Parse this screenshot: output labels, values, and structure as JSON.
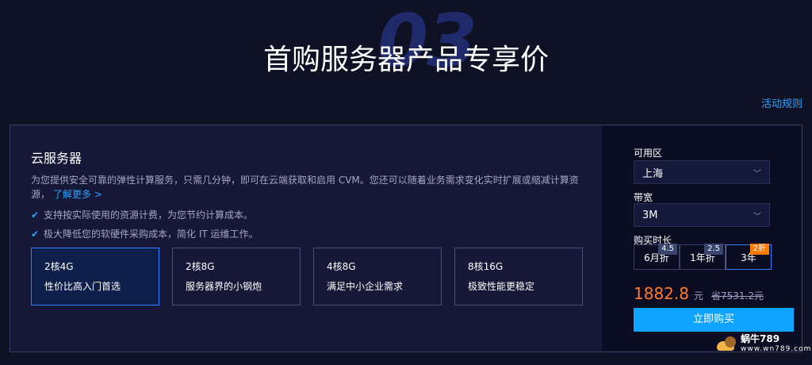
{
  "header": {
    "section_number": "03",
    "title": "首购服务器产品专享价",
    "rules_link": "活动规则"
  },
  "product": {
    "name": "云服务器",
    "description": "为您提供安全可靠的弹性计算服务，只需几分钟，即可在云端获取和启用 CVM。您还可以随着业务需求变化实时扩展或缩减计算资源，",
    "learn_more": "了解更多 >",
    "features": [
      "支持按实际使用的资源计费，为您节约计算成本。",
      "极大降低您的软硬件采购成本，简化 IT 运维工作。"
    ],
    "configs": [
      {
        "spec": "2核4G",
        "desc": "性价比高入门首选",
        "selected": true
      },
      {
        "spec": "2核8G",
        "desc": "服务器界的小钢炮",
        "selected": false
      },
      {
        "spec": "4核8G",
        "desc": "满足中小企业需求",
        "selected": false
      },
      {
        "spec": "8核16G",
        "desc": "极致性能更稳定",
        "selected": false
      }
    ]
  },
  "order": {
    "zone_label": "可用区",
    "zone_value": "上海",
    "bandwidth_label": "带宽",
    "bandwidth_value": "3M",
    "duration_label": "购买时长",
    "durations": [
      {
        "label": "6月折",
        "badge": "4.5"
      },
      {
        "label": "1年折",
        "badge": "2.5"
      },
      {
        "label": "3年",
        "badge": "2折"
      }
    ],
    "price": "1882.8",
    "price_unit": "元",
    "original_price": "省7531.2元",
    "buy_label": "立即购买"
  },
  "watermark": {
    "name": "蜗牛789",
    "url": "www.wn789.com"
  },
  "colors": {
    "background": "#0f1124",
    "accent": "#2fa4ff",
    "price": "#ff7a2d",
    "button": "#0da3ff"
  }
}
